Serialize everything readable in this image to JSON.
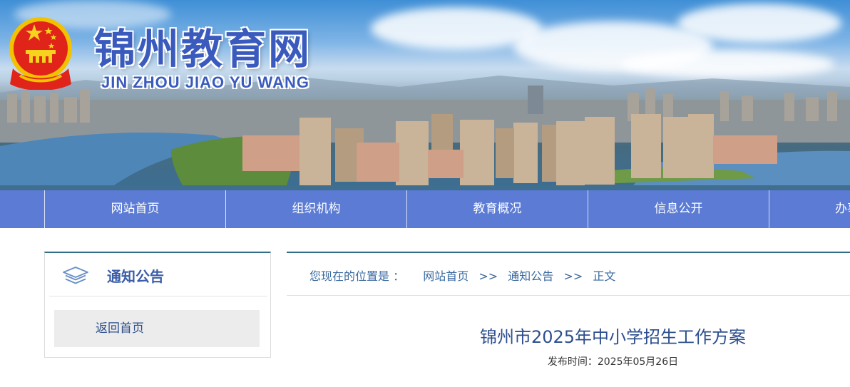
{
  "header": {
    "title": "锦州教育网",
    "subtitle": "JIN ZHOU JIAO YU WANG",
    "emblem_icon": "national-emblem-icon"
  },
  "nav": {
    "items": [
      {
        "label": "网站首页"
      },
      {
        "label": "组织机构"
      },
      {
        "label": "教育概况"
      },
      {
        "label": "信息公开"
      },
      {
        "label": "办事"
      }
    ]
  },
  "sidebar": {
    "title": "通知公告",
    "icon": "stack-layers-icon",
    "links": [
      {
        "label": "返回首页"
      }
    ]
  },
  "breadcrumb": {
    "prefix": "您现在的位置是 ：",
    "items": [
      "网站首页",
      "通知公告",
      "正文"
    ],
    "separator": ">>"
  },
  "article": {
    "title": "锦州市2025年中小学招生工作方案",
    "date_label": "发布时间：",
    "date": "2025年05月26日"
  },
  "colors": {
    "nav_bg": "#5b7bd4",
    "accent_line": "#2f6f86",
    "title_blue": "#2d4f8e",
    "link_blue": "#3b6aa0"
  }
}
